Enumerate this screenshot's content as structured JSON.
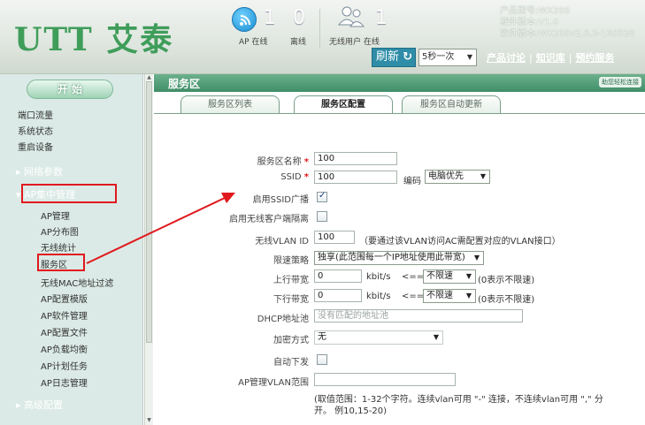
{
  "header": {
    "logo": "UTT 艾泰",
    "stats": [
      {
        "value": "1",
        "caption": "AP 在线"
      },
      {
        "value": "0",
        "caption": "离线"
      },
      {
        "value": "1",
        "caption": "无线用户 在线"
      }
    ],
    "product": {
      "model": "产品型号:WX20S",
      "hw": "硬件版本:V1.0",
      "sw": "软件版本:WX20Sv2.6.3-160520"
    },
    "refresh_label": "刷新",
    "interval": "5秒一次",
    "links": [
      "产品讨论",
      "知识库",
      "预约服务"
    ]
  },
  "sidebar": {
    "start": "开 始",
    "top_items": [
      "端口流量",
      "系统状态",
      "重启设备"
    ],
    "groups": [
      "▸ 网络参数",
      "▾ AP集中管理",
      "▸ 高级配置"
    ],
    "sub_items": [
      "AP管理",
      "AP分布图",
      "无线统计",
      "服务区",
      "无线MAC地址过滤",
      "AP配置模版",
      "AP软件管理",
      "AP配置文件",
      "AP负载均衡",
      "AP计划任务",
      "AP日志管理"
    ]
  },
  "main": {
    "title": "服务区",
    "title_right": "助您轻松连接",
    "tabs": [
      "服务区列表",
      "服务区配置",
      "服务区自动更新"
    ],
    "form": {
      "zone_name_label": "服务区名称",
      "zone_name": "100",
      "ssid_label": "SSID",
      "ssid": "100",
      "encoding_label": "编码",
      "encoding": "电脑优先",
      "ssid_broadcast_label": "启用SSID广播",
      "isolation_label": "启用无线客户端隔离",
      "vlan_label": "无线VLAN ID",
      "vlan": "100",
      "vlan_note": "（要通过该VLAN访问AC需配置对应的VLAN接口）",
      "rate_policy_label": "限速策略",
      "rate_policy": "独享(此范围每一个IP地址使用此带宽)",
      "up_label": "上行带宽",
      "up_value": "0",
      "down_label": "下行带宽",
      "down_value": "0",
      "unit": "kbit/s",
      "le": "<==",
      "unlimited": "不限速",
      "zero_note": "(0表示不限速)",
      "dhcp_label": "DHCP地址池",
      "dhcp_placeholder": "没有匹配的地址池",
      "encrypt_label": "加密方式",
      "encrypt": "无",
      "auto_label": "自动下发",
      "ap_vlan_label": "AP管理VLAN范围",
      "ap_vlan_note_1": "(取值范围：1-32个字符。连续vlan可用 \"-\" 连接，不连续vlan可用 \",\" 分",
      "ap_vlan_note_2": "开。 例10,15-20)"
    }
  },
  "colors": {
    "highlight": "#e0191e",
    "brand": "#3f9d5a"
  }
}
